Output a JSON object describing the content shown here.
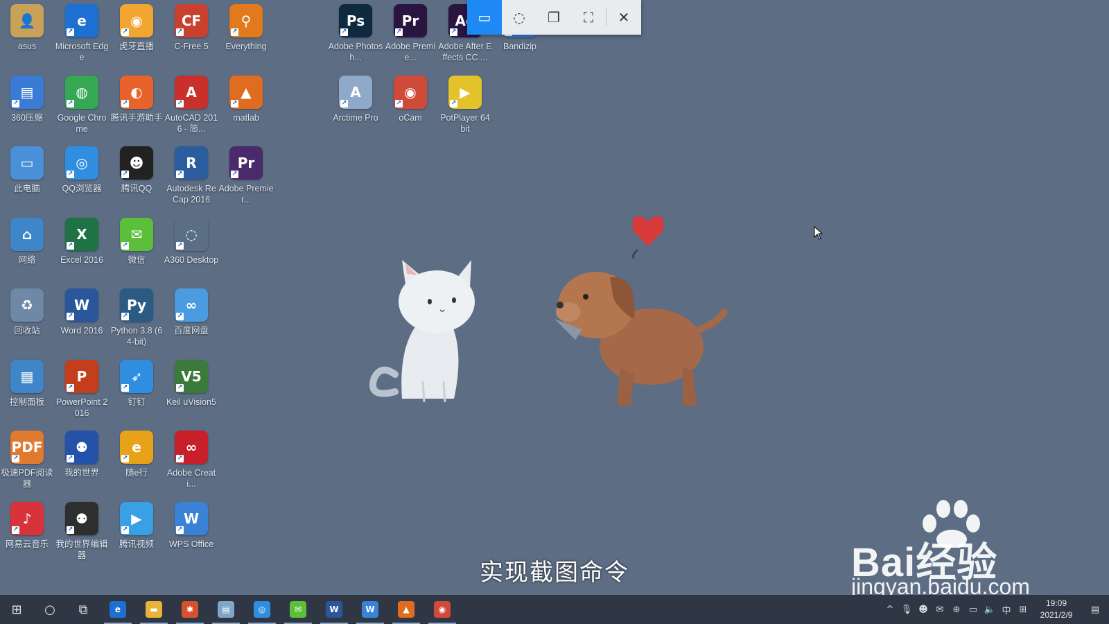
{
  "desktop_icons": [
    {
      "label": "asus",
      "symbol": "👤",
      "color": "#c9a25a"
    },
    {
      "label": "Microsoft Edge",
      "symbol": "e",
      "color": "#1d6fd1"
    },
    {
      "label": "虎牙直播",
      "symbol": "◉",
      "color": "#f2a531"
    },
    {
      "label": "C-Free 5",
      "symbol": "CF",
      "color": "#c9402f"
    },
    {
      "label": "Everything",
      "symbol": "⚲",
      "color": "#e07a1d"
    },
    {
      "label": "360压缩",
      "symbol": "▤",
      "color": "#3a7bd5"
    },
    {
      "label": "Google Chrome",
      "symbol": "◍",
      "color": "#34a853"
    },
    {
      "label": "腾讯手游助手",
      "symbol": "◐",
      "color": "#e8632b"
    },
    {
      "label": "AutoCAD 2016 - 简...",
      "symbol": "A",
      "color": "#c9302c"
    },
    {
      "label": "matlab",
      "symbol": "▲",
      "color": "#e06c1f"
    },
    {
      "label": "此电脑",
      "symbol": "▭",
      "color": "#4a90d9"
    },
    {
      "label": "QQ浏览器",
      "symbol": "◎",
      "color": "#2f8ee0"
    },
    {
      "label": "腾讯QQ",
      "symbol": "☻",
      "color": "#222222"
    },
    {
      "label": "Autodesk ReCap 2016",
      "symbol": "R",
      "color": "#2b5c9e"
    },
    {
      "label": "Adobe Premier...",
      "symbol": "Pr",
      "color": "#4a2a6a"
    },
    {
      "label": "网络",
      "symbol": "⌂",
      "color": "#3f86c8"
    },
    {
      "label": "Excel 2016",
      "symbol": "X",
      "color": "#1f7244"
    },
    {
      "label": "微信",
      "symbol": "✉",
      "color": "#5cbf3a"
    },
    {
      "label": "A360 Desktop",
      "symbol": "◌",
      "color": "#5a6f86"
    },
    {
      "label": "回收站",
      "symbol": "♻",
      "color": "#6e88a5"
    },
    {
      "label": "Word 2016",
      "symbol": "W",
      "color": "#2b579a"
    },
    {
      "label": "Python 3.8 (64-bit)",
      "symbol": "Py",
      "color": "#2b5b84"
    },
    {
      "label": "百度网盘",
      "symbol": "∞",
      "color": "#4a9be0"
    },
    {
      "label": "控制面板",
      "symbol": "▦",
      "color": "#3f86c8"
    },
    {
      "label": "PowerPoint 2016",
      "symbol": "P",
      "color": "#c43e1c"
    },
    {
      "label": "钉钉",
      "symbol": "➶",
      "color": "#2f8ee0"
    },
    {
      "label": "Keil uVision5",
      "symbol": "V5",
      "color": "#3b7a3b"
    },
    {
      "label": "极速PDF阅读器",
      "symbol": "PDF",
      "color": "#e07a2e"
    },
    {
      "label": "我的世界",
      "symbol": "⚉",
      "color": "#2452a8"
    },
    {
      "label": "随e行",
      "symbol": "e",
      "color": "#e8a21a"
    },
    {
      "label": "Adobe Creati...",
      "symbol": "∞",
      "color": "#c8202a"
    },
    {
      "label": "网易云音乐",
      "symbol": "♪",
      "color": "#d8323a"
    },
    {
      "label": "我的世界编辑器",
      "symbol": "⚉",
      "color": "#2e2e2e"
    },
    {
      "label": "腾讯视频",
      "symbol": "▶",
      "color": "#3aa0e6"
    },
    {
      "label": "WPS Office",
      "symbol": "W",
      "color": "#3a82d6"
    },
    {
      "label": "Adobe Photosh...",
      "symbol": "Ps",
      "color": "#0f2a3e"
    },
    {
      "label": "Adobe Premie...",
      "symbol": "Pr",
      "color": "#2a1540"
    },
    {
      "label": "Adobe After Effects CC ...",
      "symbol": "Ae",
      "color": "#2a1540"
    },
    {
      "label": "Bandizip",
      "symbol": "B",
      "color": "#3a7bd5"
    },
    {
      "label": "Arctime Pro",
      "symbol": "A",
      "color": "#8fa9c8"
    },
    {
      "label": "oCam",
      "symbol": "◉",
      "color": "#d04a3a"
    },
    {
      "label": "PotPlayer 64 bit",
      "symbol": "▶",
      "color": "#e4c22a"
    }
  ],
  "snip_toolbar": {
    "buttons": [
      "rect-snip",
      "freeform-snip",
      "window-snip",
      "fullscreen-snip",
      "close"
    ]
  },
  "subtitle": "实现截图命令",
  "watermark": {
    "brand": "Bai经验",
    "url": "jingyan.baidu.com"
  },
  "taskbar": {
    "apps": [
      {
        "icon": "edge-icon",
        "symbol": "e",
        "color": "#1d6fd1"
      },
      {
        "icon": "file-explorer-icon",
        "symbol": "▬",
        "color": "#e9b338"
      },
      {
        "icon": "bluetooth-app-icon",
        "symbol": "✱",
        "color": "#d8512d"
      },
      {
        "icon": "notepad-icon",
        "symbol": "▤",
        "color": "#7fa6c9"
      },
      {
        "icon": "qq-browser-icon",
        "symbol": "◎",
        "color": "#2f8ee0"
      },
      {
        "icon": "wechat-icon",
        "symbol": "✉",
        "color": "#5cbf3a"
      },
      {
        "icon": "word-icon",
        "symbol": "W",
        "color": "#2b579a"
      },
      {
        "icon": "wps-icon",
        "symbol": "W",
        "color": "#3a82d6"
      },
      {
        "icon": "matlab-icon",
        "symbol": "▲",
        "color": "#e06c1f"
      },
      {
        "icon": "ocam-icon",
        "symbol": "◉",
        "color": "#d04a3a"
      }
    ],
    "tray": {
      "ime_lang": "中",
      "time": "19:09",
      "date": "2021/2/9"
    }
  },
  "colors": {
    "desktop_bg": "#5c6d84",
    "snip_active": "#1e88f5",
    "taskbar_bg": "#2f3744"
  }
}
